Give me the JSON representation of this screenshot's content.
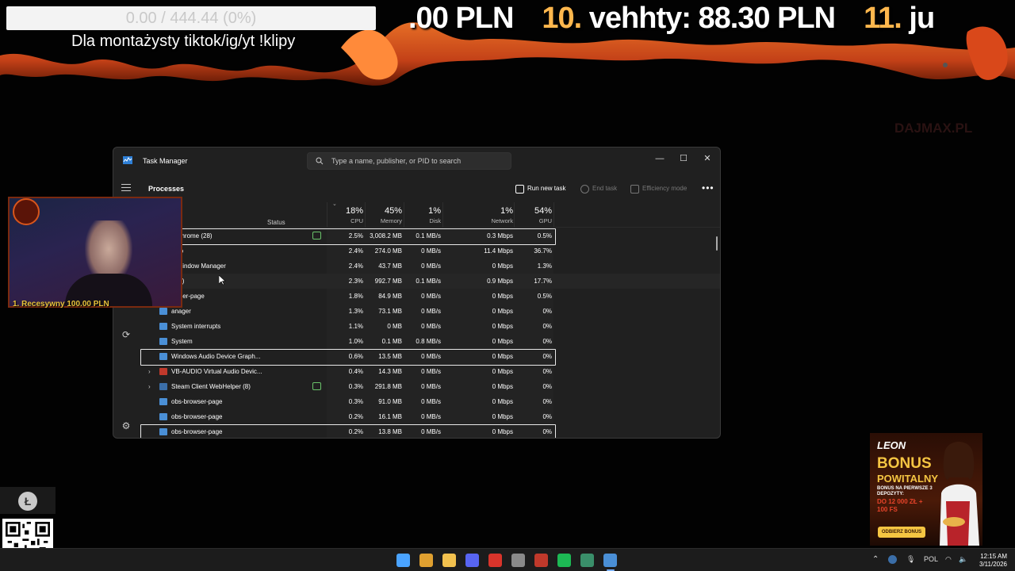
{
  "overlay": {
    "progress_text": "0.00 / 444.44 (0%)",
    "caption": "Dla montażysty tiktok/ig/yt !klipy",
    "ticker_items": [
      {
        "rank": "",
        "text": ".00 PLN"
      },
      {
        "rank": "10.",
        "text": "vehhty: 88.30 PLN"
      },
      {
        "rank": "11.",
        "text": "ju"
      }
    ],
    "watermark": "DAJMAX.PL"
  },
  "task_manager": {
    "title": "Task Manager",
    "search_placeholder": "Type a name, publisher, or PID to search",
    "page_heading": "Processes",
    "toolbar": {
      "run_new_task": "Run new task",
      "end_task": "End task",
      "efficiency_mode": "Efficiency mode",
      "more": "•••"
    },
    "window_controls": {
      "minimize": "—",
      "maximize": "☐",
      "close": "✕"
    },
    "columns": {
      "status": "Status",
      "cpu": {
        "pct": "18%",
        "label": "CPU"
      },
      "memory": {
        "pct": "45%",
        "label": "Memory"
      },
      "disk": {
        "pct": "1%",
        "label": "Disk"
      },
      "network": {
        "pct": "1%",
        "label": "Network"
      },
      "gpu": {
        "pct": "54%",
        "label": "GPU"
      }
    },
    "processes": [
      {
        "name": "e Chrome (28)",
        "cpu": "2.5%",
        "memory": "3,008.2 MB",
        "disk": "0.1 MB/s",
        "network": "0.3 Mbps",
        "gpu": "0.5%",
        "expander": "",
        "icon_color": "#e0a030",
        "eco": true,
        "selected": true,
        "hover": false
      },
      {
        "name": "udio",
        "cpu": "2.4%",
        "memory": "274.0 MB",
        "disk": "0 MB/s",
        "network": "11.4 Mbps",
        "gpu": "36.7%",
        "expander": "",
        "icon_color": "#5a5a5a",
        "eco": false,
        "selected": false,
        "hover": false
      },
      {
        "name": "p Window Manager",
        "cpu": "2.4%",
        "memory": "43.7 MB",
        "disk": "0 MB/s",
        "network": "0 Mbps",
        "gpu": "1.3%",
        "expander": "",
        "icon_color": "#4a8fd6",
        "eco": false,
        "selected": false,
        "hover": false
      },
      {
        "name": "d (6)",
        "cpu": "2.3%",
        "memory": "992.7 MB",
        "disk": "0.1 MB/s",
        "network": "0.9 Mbps",
        "gpu": "17.7%",
        "expander": "",
        "icon_color": "#5865f2",
        "eco": false,
        "selected": false,
        "hover": true
      },
      {
        "name": "owser-page",
        "cpu": "1.8%",
        "memory": "84.9 MB",
        "disk": "0 MB/s",
        "network": "0 Mbps",
        "gpu": "0.5%",
        "expander": "",
        "icon_color": "#4a8fd6",
        "eco": false,
        "selected": false,
        "hover": false
      },
      {
        "name": "anager",
        "cpu": "1.3%",
        "memory": "73.1 MB",
        "disk": "0 MB/s",
        "network": "0 Mbps",
        "gpu": "0%",
        "expander": "",
        "icon_color": "#4a8fd6",
        "eco": false,
        "selected": false,
        "hover": false
      },
      {
        "name": "System interrupts",
        "cpu": "1.1%",
        "memory": "0 MB",
        "disk": "0 MB/s",
        "network": "0 Mbps",
        "gpu": "0%",
        "expander": "",
        "icon_color": "#4a8fd6",
        "eco": false,
        "selected": false,
        "hover": false
      },
      {
        "name": "System",
        "cpu": "1.0%",
        "memory": "0.1 MB",
        "disk": "0.8 MB/s",
        "network": "0 Mbps",
        "gpu": "0%",
        "expander": "",
        "icon_color": "#4a8fd6",
        "eco": false,
        "selected": false,
        "hover": false
      },
      {
        "name": "Windows Audio Device Graph...",
        "cpu": "0.6%",
        "memory": "13.5 MB",
        "disk": "0 MB/s",
        "network": "0 Mbps",
        "gpu": "0%",
        "expander": "",
        "icon_color": "#4a8fd6",
        "eco": false,
        "selected": true,
        "hover": false
      },
      {
        "name": "VB-AUDIO Virtual Audio Devic...",
        "cpu": "0.4%",
        "memory": "14.3 MB",
        "disk": "0 MB/s",
        "network": "0 Mbps",
        "gpu": "0%",
        "expander": "›",
        "icon_color": "#c0392b",
        "eco": false,
        "selected": false,
        "hover": false
      },
      {
        "name": "Steam Client WebHelper (8)",
        "cpu": "0.3%",
        "memory": "291.8 MB",
        "disk": "0 MB/s",
        "network": "0 Mbps",
        "gpu": "0%",
        "expander": "›",
        "icon_color": "#3b6ea8",
        "eco": true,
        "selected": false,
        "hover": false
      },
      {
        "name": "obs-browser-page",
        "cpu": "0.3%",
        "memory": "91.0 MB",
        "disk": "0 MB/s",
        "network": "0 Mbps",
        "gpu": "0%",
        "expander": "",
        "icon_color": "#4a8fd6",
        "eco": false,
        "selected": false,
        "hover": false
      },
      {
        "name": "obs-browser-page",
        "cpu": "0.2%",
        "memory": "16.1 MB",
        "disk": "0 MB/s",
        "network": "0 Mbps",
        "gpu": "0%",
        "expander": "",
        "icon_color": "#4a8fd6",
        "eco": false,
        "selected": false,
        "hover": false
      },
      {
        "name": "obs-browser-page",
        "cpu": "0.2%",
        "memory": "13.8 MB",
        "disk": "0 MB/s",
        "network": "0 Mbps",
        "gpu": "0%",
        "expander": "",
        "icon_color": "#4a8fd6",
        "eco": false,
        "selected": true,
        "hover": false
      }
    ]
  },
  "webcam": {
    "tag": "1.  Recesywny   100.00 PLN"
  },
  "ad": {
    "brand": "LEON",
    "headline1": "BONUS",
    "headline2": "POWITALNY",
    "small": "BONUS NA PIERWSZE 3 DEPOZYTY:",
    "amount": "DO 12 000 ZŁ + 100 FS",
    "cta": "ODBIERZ BONUS"
  },
  "lite_icon": "Ł",
  "taskbar": {
    "apps": [
      {
        "name": "start-icon",
        "color": "#4aa3ff"
      },
      {
        "name": "chrome-icon",
        "color": "#e0a030"
      },
      {
        "name": "file-explorer-icon",
        "color": "#f2c14e"
      },
      {
        "name": "discord-icon",
        "color": "#5865f2"
      },
      {
        "name": "music-app-icon",
        "color": "#d9342b"
      },
      {
        "name": "settings-icon",
        "color": "#8a8a8a"
      },
      {
        "name": "spotify-like-red-icon",
        "color": "#c0392b"
      },
      {
        "name": "spotify-icon",
        "color": "#1db954"
      },
      {
        "name": "app-leaf-icon",
        "color": "#3a8f6a"
      },
      {
        "name": "task-manager-icon",
        "color": "#4a8fd6"
      }
    ],
    "language": "POL",
    "time": "12:15 AM",
    "date": "3/11/2026"
  }
}
